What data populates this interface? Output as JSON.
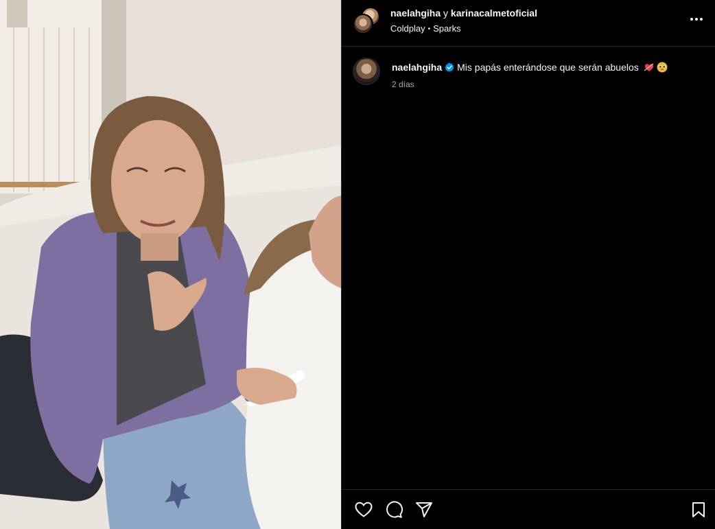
{
  "header": {
    "user1": "naelahgiha",
    "conjunction": "y",
    "user2": "karinacalmetoficial",
    "audio_artist": "Coldplay",
    "audio_song": "Sparks",
    "more_icon": "more-horizontal-icon"
  },
  "caption": {
    "username": "naelahgiha",
    "verified_icon": "verified-badge-icon",
    "text": "Mis papás enterándose que serán abuelos",
    "emojis": [
      "heart-arrow-emoji",
      "pleading-face-emoji"
    ],
    "time": "2 días"
  },
  "actions": {
    "like_icon": "heart-icon",
    "comment_icon": "comment-icon",
    "share_icon": "send-icon",
    "save_icon": "bookmark-icon"
  },
  "colors": {
    "background": "#000000",
    "text": "#f5f5f5",
    "muted": "#a8a8a8",
    "divider": "#262626",
    "verified": "#0095f6"
  }
}
